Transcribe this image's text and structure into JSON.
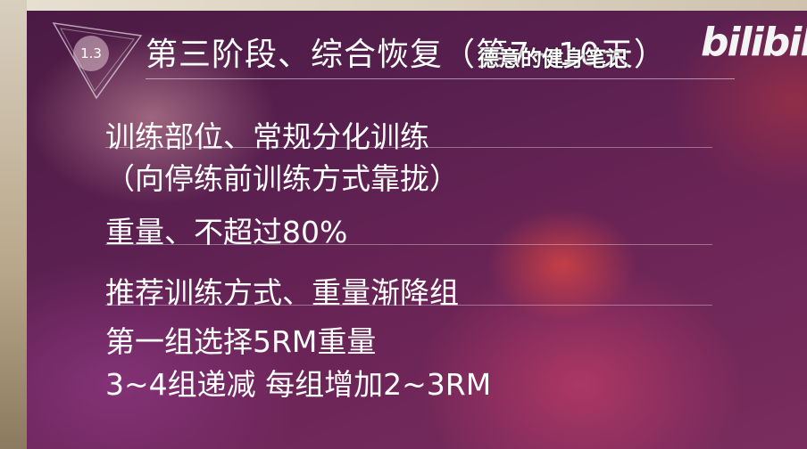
{
  "slide": {
    "badge": "1.3",
    "title": "第三阶段、综合恢复（第7~10天）",
    "lines": [
      "训练部位、常规分化训练",
      "（向停练前训练方式靠拢）",
      "重量、不超过80%",
      "推荐训练方式、重量渐降组",
      "第一组选择5RM重量",
      "3~4组递减 每组增加2~3RM"
    ]
  },
  "watermark": {
    "author": "德意的健身笔记",
    "logo": "bilibili"
  }
}
